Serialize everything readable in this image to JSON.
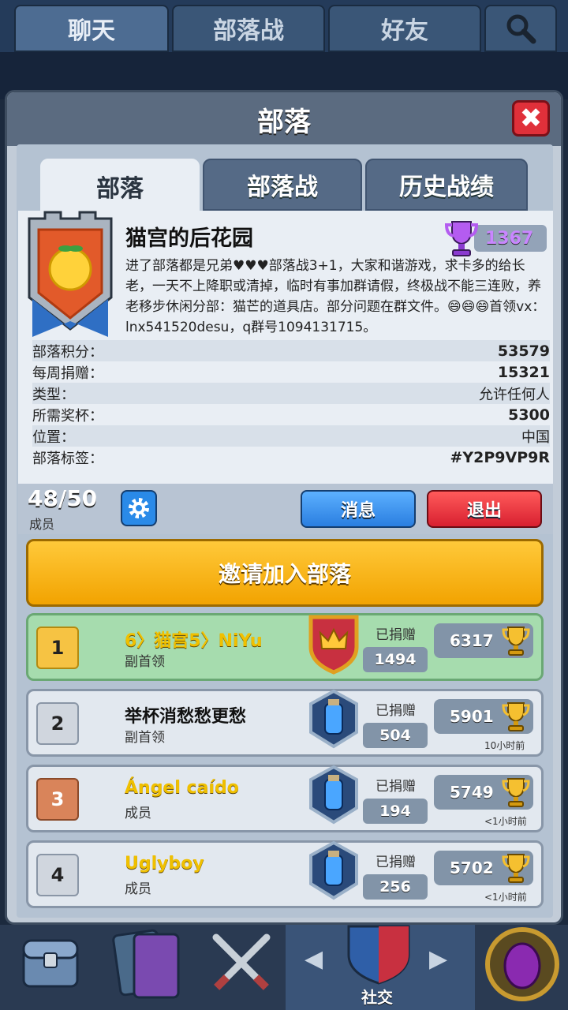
{
  "top_tabs": [
    "聊天",
    "部落战",
    "好友"
  ],
  "modal_title": "部落",
  "close_label": "✖",
  "panel_tabs": [
    "部落",
    "部落战",
    "历史战绩"
  ],
  "clan": {
    "name": "猫宫的后花园",
    "trophies": "1367",
    "description": "进了部落都是兄弟♥♥♥部落战3+1，大家和谐游戏，求卡多的给长老，一天不上降职或清掉，临时有事加群请假，终极战不能三连败，养老移步休闲分部：猫芒的道具店。部分问题在群文件。😄😄😄首领vx：lnx541520desu，q群号1094131715。",
    "stats": [
      {
        "label": "部落积分：",
        "value": "53579"
      },
      {
        "label": "每周捐赠：",
        "value": "15321"
      },
      {
        "label": "类型：",
        "value": "允许任何人"
      },
      {
        "label": "所需奖杯：",
        "value": "5300"
      },
      {
        "label": "位置：",
        "value": "中国"
      },
      {
        "label": "部落标签：",
        "value": "#Y2P9VP9R"
      }
    ]
  },
  "members_count": "48/50",
  "members_label": "成员",
  "buttons": {
    "message": "消息",
    "leave": "退出",
    "invite": "邀请加入部落"
  },
  "donated_label": "已捐赠",
  "members": [
    {
      "rank": "1",
      "name": "6〉猫宫5〉NiYu",
      "role": "副首领",
      "donated": "1494",
      "trophies": "6317",
      "time": ""
    },
    {
      "rank": "2",
      "name": "举杯消愁愁更愁",
      "role": "副首领",
      "donated": "504",
      "trophies": "5901",
      "time": "10小时前"
    },
    {
      "rank": "3",
      "name": "Ángel caído",
      "role": "成员",
      "donated": "194",
      "trophies": "5749",
      "time": "<1小时前"
    },
    {
      "rank": "4",
      "name": "Uglyboy",
      "role": "成员",
      "donated": "256",
      "trophies": "5702",
      "time": "<1小时前"
    }
  ],
  "bottom_nav_label": "社交",
  "colors": {
    "trophy_purple": "#c986ff",
    "leave_red": "#e0303a",
    "message_blue": "#2a8ae8",
    "invite_gold": "#f2a300"
  }
}
